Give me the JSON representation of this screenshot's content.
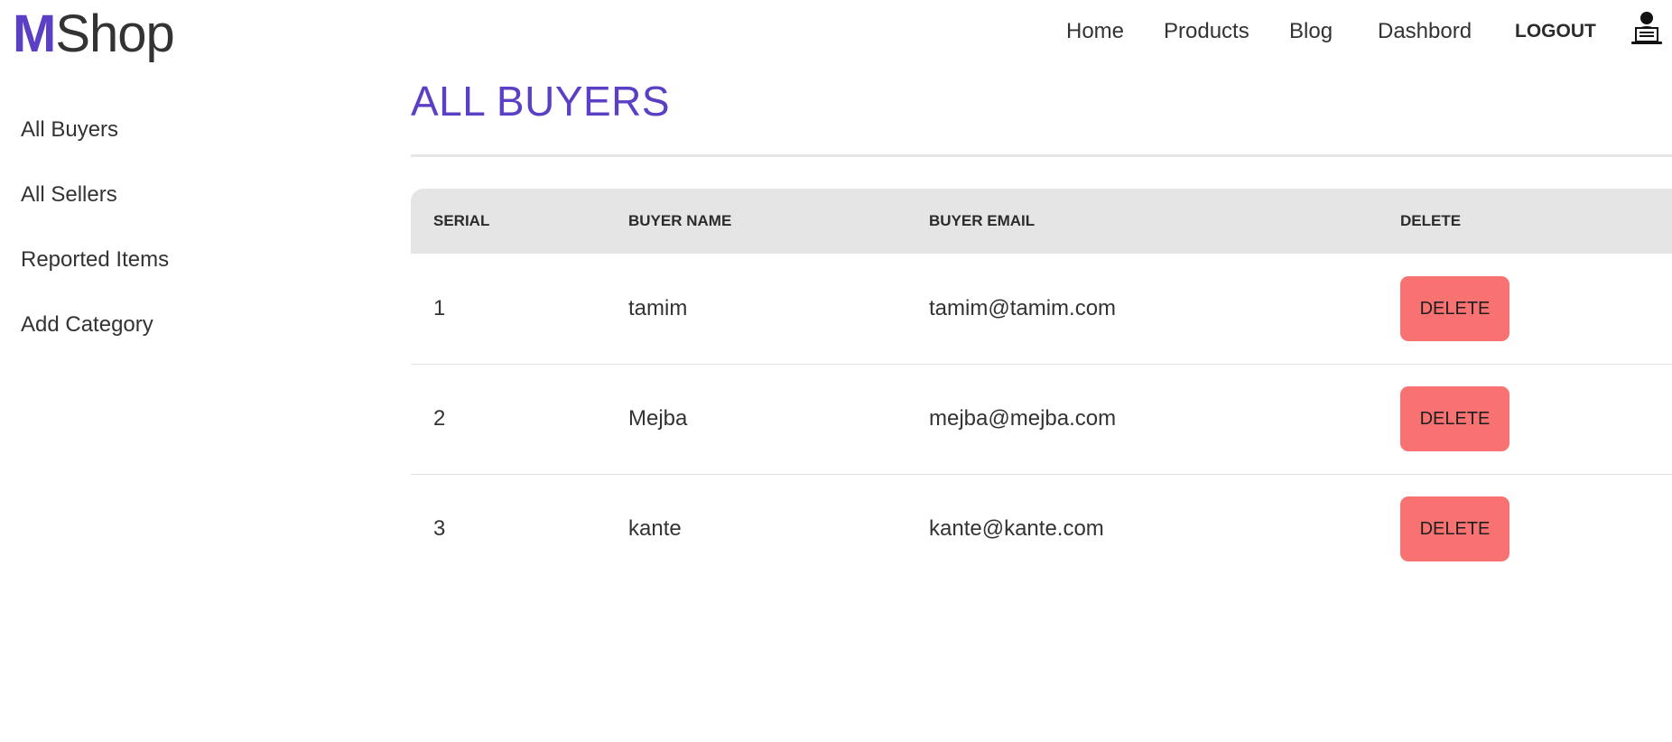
{
  "brand": {
    "initial": "M",
    "rest": "Shop"
  },
  "nav": {
    "items": [
      {
        "label": "Home"
      },
      {
        "label": "Products"
      },
      {
        "label": "Blog"
      },
      {
        "label": "Dashbord"
      }
    ],
    "logout_label": "LOGOUT",
    "avatar_icon": "user-laptop-icon"
  },
  "sidebar": {
    "items": [
      {
        "label": "All Buyers"
      },
      {
        "label": "All Sellers"
      },
      {
        "label": "Reported Items"
      },
      {
        "label": "Add Category"
      }
    ]
  },
  "main": {
    "title": "ALL BUYERS",
    "accent_color": "#5b3fc4",
    "table": {
      "columns": [
        "SERIAL",
        "BUYER NAME",
        "BUYER EMAIL",
        "DELETE"
      ],
      "rows": [
        {
          "serial": "1",
          "name": "tamim",
          "email": "tamim@tamim.com",
          "action": "DELETE"
        },
        {
          "serial": "2",
          "name": "Mejba",
          "email": "mejba@mejba.com",
          "action": "DELETE"
        },
        {
          "serial": "3",
          "name": "kante",
          "email": "kante@kante.com",
          "action": "DELETE"
        }
      ],
      "delete_button_color": "#f87272"
    }
  }
}
